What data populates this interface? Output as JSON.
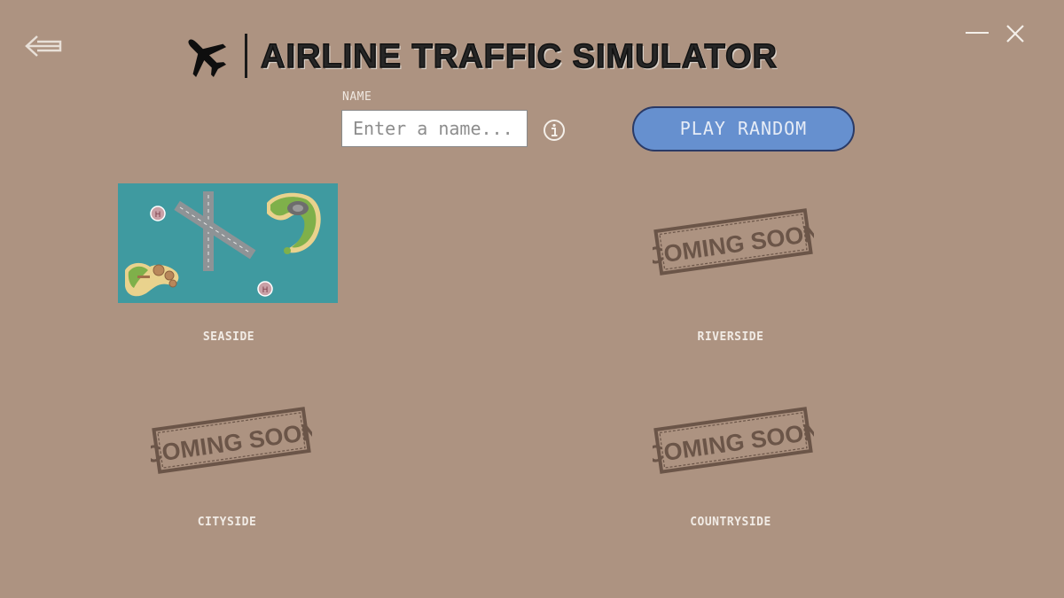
{
  "app": {
    "title": "AIRLINE TRAFFIC SIMULATOR",
    "logo_icon": "airplane-icon"
  },
  "window_controls": {
    "back_icon": "back-arrow-icon",
    "minimize_icon": "minimize-icon",
    "close_icon": "close-icon"
  },
  "name_field": {
    "label": "NAME",
    "value": "",
    "placeholder": "Enter a name...",
    "info_icon": "info-icon"
  },
  "play_random": {
    "label": "PLAY RANDOM"
  },
  "levels": [
    {
      "name": "SEASIDE",
      "available": true
    },
    {
      "name": "RIVERSIDE",
      "available": false,
      "stamp_text": "COMING SOON"
    },
    {
      "name": "CITYSIDE",
      "available": false,
      "stamp_text": "COMING SOON"
    },
    {
      "name": "COUNTRYSIDE",
      "available": false,
      "stamp_text": "COMING SOON"
    }
  ],
  "colors": {
    "background": "#ad9381",
    "button": "#6690cf",
    "button_border": "#2a3a66",
    "label": "#f1ebe5",
    "stamp": "#6b5548",
    "sea": "#3f9aa0"
  }
}
